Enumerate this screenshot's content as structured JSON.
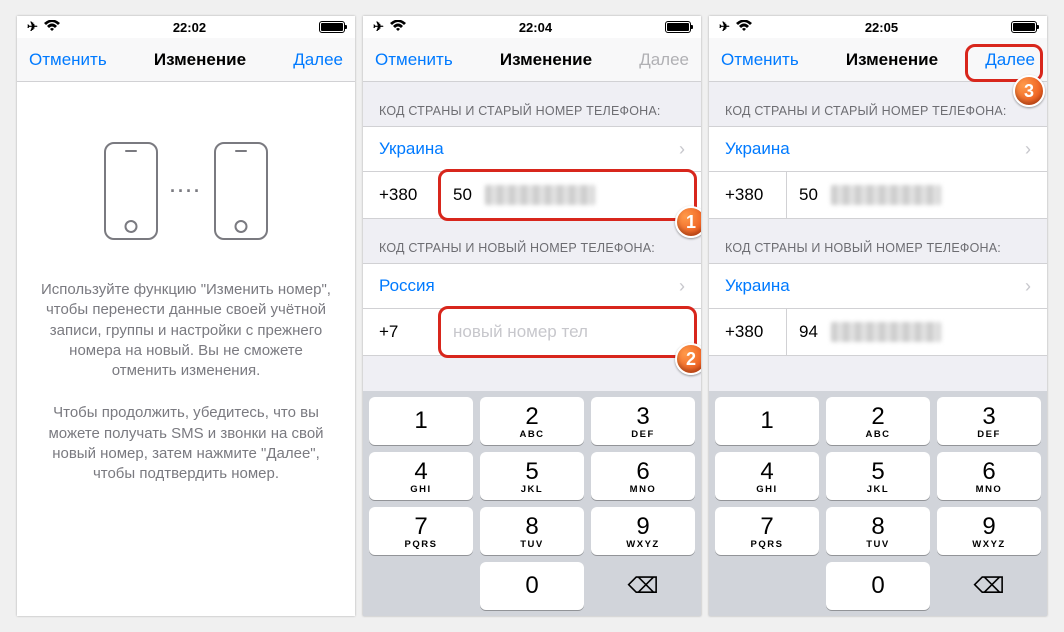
{
  "screens": [
    {
      "statusbar": {
        "time": "22:02"
      },
      "navbar": {
        "cancel": "Отменить",
        "title": "Изменение",
        "next": "Далее",
        "next_enabled": true,
        "highlight_next": false
      },
      "intro": {
        "p1": "Используйте функцию \"Изменить номер\", чтобы перенести данные своей учётной записи, группы и настройки с прежнего номера на новый. Вы не сможете отменить изменения.",
        "p2": "Чтобы продолжить, убедитесь, что вы можете получать SMS и звонки на свой новый номер, затем нажмите \"Далее\", чтобы подтвердить номер."
      }
    },
    {
      "statusbar": {
        "time": "22:04"
      },
      "navbar": {
        "cancel": "Отменить",
        "title": "Изменение",
        "next": "Далее",
        "next_enabled": false,
        "highlight_next": false
      },
      "form": {
        "old_label": "КОД СТРАНЫ И СТАРЫЙ НОМЕР ТЕЛЕФОНА:",
        "old_country": "Украина",
        "old_dial": "+380",
        "old_prefix": "50",
        "old_highlight": true,
        "new_label": "КОД СТРАНЫ И НОВЫЙ НОМЕР ТЕЛЕФОНА:",
        "new_country": "Россия",
        "new_dial": "+7",
        "new_placeholder": "новый номер тел",
        "new_highlight": true
      },
      "callouts": {
        "c1": true,
        "c2": true
      }
    },
    {
      "statusbar": {
        "time": "22:05"
      },
      "navbar": {
        "cancel": "Отменить",
        "title": "Изменение",
        "next": "Далее",
        "next_enabled": true,
        "highlight_next": true
      },
      "form": {
        "old_label": "КОД СТРАНЫ И СТАРЫЙ НОМЕР ТЕЛЕФОНА:",
        "old_country": "Украина",
        "old_dial": "+380",
        "old_prefix": "50",
        "old_highlight": false,
        "new_label": "КОД СТРАНЫ И НОВЫЙ НОМЕР ТЕЛЕФОНА:",
        "new_country": "Украина",
        "new_dial": "+380",
        "new_prefix": "94",
        "new_highlight": false
      },
      "callouts": {
        "c3": true
      }
    }
  ],
  "keypad": [
    {
      "d": "1",
      "s": ""
    },
    {
      "d": "2",
      "s": "ABC"
    },
    {
      "d": "3",
      "s": "DEF"
    },
    {
      "d": "4",
      "s": "GHI"
    },
    {
      "d": "5",
      "s": "JKL"
    },
    {
      "d": "6",
      "s": "MNO"
    },
    {
      "d": "7",
      "s": "PQRS"
    },
    {
      "d": "8",
      "s": "TUV"
    },
    {
      "d": "9",
      "s": "WXYZ"
    },
    {
      "d": "",
      "s": ""
    },
    {
      "d": "0",
      "s": ""
    },
    {
      "d": "⌫",
      "s": ""
    }
  ]
}
